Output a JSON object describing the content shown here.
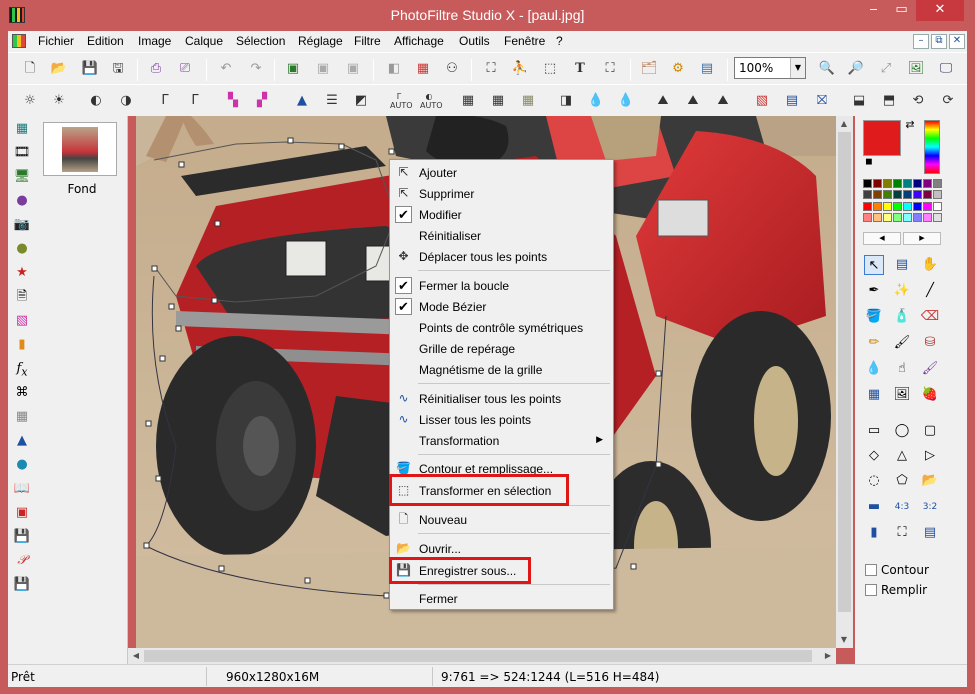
{
  "window": {
    "title": "PhotoFiltre Studio X - [paul.jpg]",
    "min": "‒",
    "max": "▭",
    "close": "✕"
  },
  "menu": [
    "Fichier",
    "Edition",
    "Image",
    "Calque",
    "Sélection",
    "Réglage",
    "Filtre",
    "Affichage",
    "Outils",
    "Fenêtre",
    "?"
  ],
  "zoom": {
    "value": "100%"
  },
  "layers": [
    {
      "name": "Fond"
    }
  ],
  "context_menu": {
    "items": [
      {
        "label": "Ajouter",
        "icon": "add-point-icon"
      },
      {
        "label": "Supprimer",
        "icon": "remove-point-icon"
      },
      {
        "label": "Modifier",
        "checked": true
      },
      {
        "label": "Réinitialiser"
      },
      {
        "label": "Déplacer tous les points",
        "icon": "move-icon"
      },
      {
        "label": "Fermer la boucle",
        "checked": true
      },
      {
        "label": "Mode Bézier",
        "checked": true
      },
      {
        "label": "Points de contrôle symétriques"
      },
      {
        "label": "Grille de repérage"
      },
      {
        "label": "Magnétisme de la grille"
      },
      {
        "label": "Réinitialiser tous les points",
        "icon": "curve-icon"
      },
      {
        "label": "Lisser tous les points",
        "icon": "smooth-curve-icon"
      },
      {
        "label": "Transformation",
        "submenu": true
      },
      {
        "label": "Contour et remplissage...",
        "icon": "paint-bucket-icon"
      },
      {
        "label": "Transformer en sélection",
        "icon": "selection-icon",
        "highlighted": true
      },
      {
        "label": "Nouveau",
        "icon": "new-document-icon"
      },
      {
        "label": "Ouvrir...",
        "icon": "open-folder-icon"
      },
      {
        "label": "Enregistrer sous...",
        "icon": "save-icon",
        "highlighted": true
      },
      {
        "label": "Fermer"
      }
    ]
  },
  "right_panel": {
    "contour_label": "Contour",
    "fill_label": "Remplir"
  },
  "status": {
    "ready": "Prêt",
    "image_size": "960x1280x16M",
    "coords": "9:761 => 524:1244 (L=516  H=484)"
  },
  "colors": {
    "accent": "#c75b5b",
    "highlight": "#e01616",
    "foreground": "#e01b1b",
    "background": "#ffffff"
  }
}
